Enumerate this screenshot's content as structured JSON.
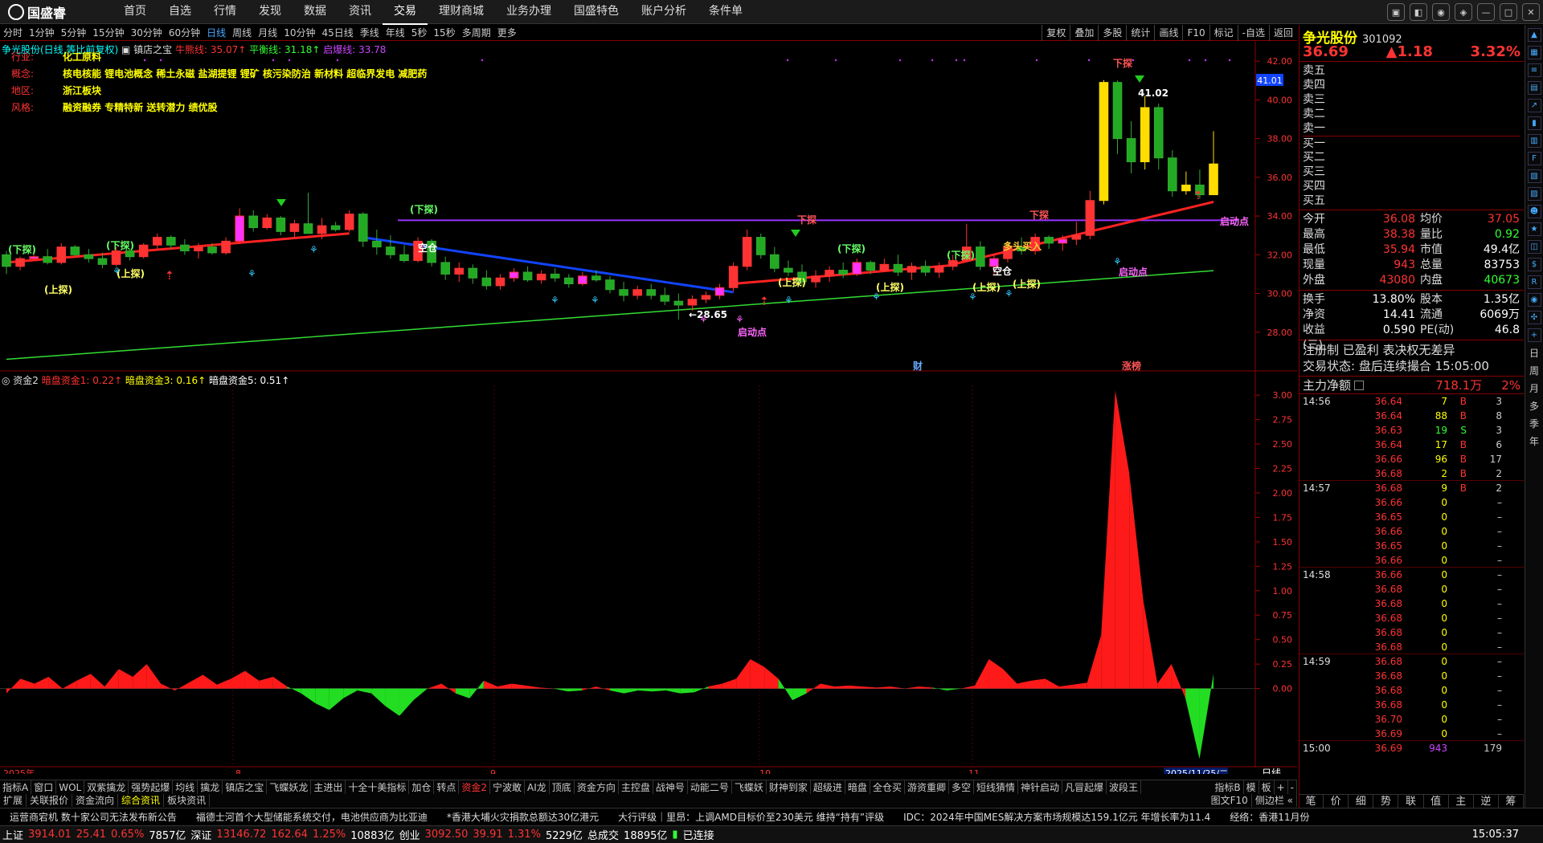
{
  "app": {
    "logo": "国盛睿"
  },
  "menu": [
    "首页",
    "自选",
    "行情",
    "发现",
    "数据",
    "资讯",
    "交易",
    "理财商城",
    "业务办理",
    "国盛特色",
    "账户分析",
    "条件单"
  ],
  "menu_active": 6,
  "window_controls": [
    "msg",
    "min-chat",
    "user",
    "stack",
    "min",
    "max",
    "close"
  ],
  "periods": [
    "分时",
    "1分钟",
    "5分钟",
    "15分钟",
    "30分钟",
    "60分钟",
    "日线",
    "周线",
    "月线",
    "10分钟",
    "45日线",
    "季线",
    "年线",
    "5秒",
    "15秒",
    "多周期",
    "更多"
  ],
  "period_active": 6,
  "right_tools": [
    "复权",
    "叠加",
    "多股",
    "统计",
    "画线",
    "F10",
    "标记",
    "-自选",
    "返回"
  ],
  "chart_header": {
    "stock": "争光股份(日线,等比前复权)",
    "indicator": "镇店之宝",
    "line1": "牛熊线: 35.07↑",
    "line2": "平衡线: 31.18↑",
    "line3": "启爆线: 33.78"
  },
  "info_rows": [
    {
      "k": "行业:",
      "v": "化工原料"
    },
    {
      "k": "概念:",
      "v": "核电核能 锂电池概念 稀土永磁 盐湖提锂 锂矿 核污染防治 新材料 超临界发电 减肥药"
    },
    {
      "k": "地区:",
      "v": "浙江板块"
    },
    {
      "k": "风格:",
      "v": "融资融券 专精特新 送转潜力 绩优股"
    }
  ],
  "sub_header": {
    "name": "资金2",
    "a": "暗盘资金1: 0.22↑",
    "b": "暗盘资金3: 0.16↑",
    "c": "暗盘资金5: 0.51↑"
  },
  "x_axis_labels": [
    {
      "text": "2025年",
      "month": "Jul"
    },
    {
      "text": "8",
      "month": "Aug"
    },
    {
      "text": "9",
      "month": "Sep"
    },
    {
      "text": "10",
      "month": "Oct"
    },
    {
      "text": "11",
      "month": "Nov"
    },
    {
      "text": "2025/11/25/二",
      "month": "cursor"
    }
  ],
  "x_axis_right": "日线",
  "chart_labels": {
    "up_probe": "(上探)",
    "down_probe": "(下探)",
    "down_probe2": "下探",
    "start_point": "启动点",
    "empty_pos": "空仓",
    "buy": "多头买入",
    "low_mark": "←28.65",
    "high_mark": "41.02",
    "fin": "财",
    "limit": "涨榜",
    "price_tag": "41.01"
  },
  "indicator_tabs": [
    "指标A",
    "窗口",
    "WOL",
    "双紫擒龙",
    "强势起爆",
    "均线",
    "擒龙",
    "镇店之宝",
    "飞蝶妖龙",
    "主进出",
    "十全十美指标",
    "加仓",
    "转点",
    "资金2",
    "宁波敢",
    "AI龙",
    "顶底",
    "资金方向",
    "主控盘",
    "战神号",
    "动能二号",
    "飞蝶妖",
    "财神到家",
    "超级进",
    "暗盘",
    "全仓买",
    "游资重卿",
    "多空",
    "短线猜情",
    "神针启动",
    "凡冒起爆",
    "波段王"
  ],
  "indicator_active": 13,
  "indicator_right": [
    "指标B",
    "模",
    "板",
    "+",
    "-"
  ],
  "bottom_tabs": [
    "扩展",
    "关联报价",
    "资金流向",
    "综合资讯",
    "板块资讯"
  ],
  "bottom_tab_active": 3,
  "bottom_right_tabs": [
    "图文F10",
    "侧边栏 «"
  ],
  "news": [
    "运营商宕机 数十家公司无法发布新公告",
    "福德士河首个大型储能系统交付，电池供应商为比亚迪",
    "*香港大埔火灾捐款总额达30亿港元",
    "大行评级｜里昂：上调AMD目标价至230美元 维持“持有”评级",
    "IDC：2024年中国MES解决方案市场规模达159.1亿元 年增长率为11.4",
    "经络：香港11月份"
  ],
  "status": {
    "sh": {
      "name": "上证",
      "v": "3914.01",
      "chg": "25.41",
      "pct": "0.65%",
      "amt": "7857亿"
    },
    "sz": {
      "name": "深证",
      "v": "13146.72",
      "chg": "162.64",
      "pct": "1.25%",
      "amt": "10883亿"
    },
    "cy": {
      "name": "创业",
      "v": "3092.50",
      "chg": "39.91",
      "pct": "1.31%",
      "amt": "5229亿"
    },
    "total_label": "总成交",
    "total": "18895亿",
    "conn": "已连接",
    "time": "15:05:37"
  },
  "quote": {
    "name": "争光股份",
    "code": "301092",
    "price": "36.69",
    "chg": "▲1.18",
    "pct": "3.32%",
    "asks": [
      "卖五",
      "卖四",
      "卖三",
      "卖二",
      "卖一"
    ],
    "bids": [
      "买一",
      "买二",
      "买三",
      "买四",
      "买五"
    ],
    "stats": [
      {
        "l": "今开",
        "v": "36.08",
        "vc": "red",
        "l2": "均价",
        "v2": "37.05",
        "v2c": "red"
      },
      {
        "l": "最高",
        "v": "38.38",
        "vc": "red",
        "l2": "量比",
        "v2": "0.92",
        "v2c": "green"
      },
      {
        "l": "最低",
        "v": "35.94",
        "vc": "red",
        "l2": "市值",
        "v2": "49.4亿",
        "v2c": "white"
      },
      {
        "l": "现量",
        "v": "943",
        "vc": "red",
        "l2": "总量",
        "v2": "83753",
        "v2c": "white"
      },
      {
        "l": "外盘",
        "v": "43080",
        "vc": "red",
        "l2": "内盘",
        "v2": "40673",
        "v2c": "green"
      }
    ],
    "stats2": [
      {
        "l": "换手",
        "v": "13.80%",
        "l2": "股本",
        "v2": "1.35亿"
      },
      {
        "l": "净资",
        "v": "14.41",
        "l2": "流通",
        "v2": "6069万"
      },
      {
        "l": "收益(三)",
        "v": "0.590",
        "l2": "PE(动)",
        "v2": "46.8"
      }
    ],
    "note1": "注册制 已盈利 表决权无差异",
    "note2": "交易状态: 盘后连续撮合 15:05:00",
    "mainflow_label": "主力净额",
    "mainflow_value": "718.1万",
    "mainflow_pct": "2%",
    "ticks": [
      {
        "t": "14:56",
        "p": "36.64",
        "v": "7",
        "s": "B",
        "n": "3"
      },
      {
        "t": "",
        "p": "36.64",
        "v": "88",
        "s": "B",
        "n": "8"
      },
      {
        "t": "",
        "p": "36.63",
        "v": "19",
        "s": "S",
        "n": "3"
      },
      {
        "t": "",
        "p": "36.64",
        "v": "17",
        "s": "B",
        "n": "6"
      },
      {
        "t": "",
        "p": "36.66",
        "v": "96",
        "s": "B",
        "n": "17"
      },
      {
        "t": "",
        "p": "36.68",
        "v": "2",
        "s": "B",
        "n": "2"
      },
      {
        "t": "14:57",
        "p": "36.68",
        "v": "9",
        "s": "B",
        "n": "2"
      },
      {
        "t": "",
        "p": "36.66",
        "v": "0",
        "s": "",
        "n": "–"
      },
      {
        "t": "",
        "p": "36.65",
        "v": "0",
        "s": "",
        "n": "–"
      },
      {
        "t": "",
        "p": "36.66",
        "v": "0",
        "s": "",
        "n": "–"
      },
      {
        "t": "",
        "p": "36.65",
        "v": "0",
        "s": "",
        "n": "–"
      },
      {
        "t": "",
        "p": "36.66",
        "v": "0",
        "s": "",
        "n": "–"
      },
      {
        "t": "14:58",
        "p": "36.66",
        "v": "0",
        "s": "",
        "n": "–"
      },
      {
        "t": "",
        "p": "36.68",
        "v": "0",
        "s": "",
        "n": "–"
      },
      {
        "t": "",
        "p": "36.68",
        "v": "0",
        "s": "",
        "n": "–"
      },
      {
        "t": "",
        "p": "36.68",
        "v": "0",
        "s": "",
        "n": "–"
      },
      {
        "t": "",
        "p": "36.68",
        "v": "0",
        "s": "",
        "n": "–"
      },
      {
        "t": "",
        "p": "36.68",
        "v": "0",
        "s": "",
        "n": "–"
      },
      {
        "t": "14:59",
        "p": "36.68",
        "v": "0",
        "s": "",
        "n": "–"
      },
      {
        "t": "",
        "p": "36.68",
        "v": "0",
        "s": "",
        "n": "–"
      },
      {
        "t": "",
        "p": "36.68",
        "v": "0",
        "s": "",
        "n": "–"
      },
      {
        "t": "",
        "p": "36.68",
        "v": "0",
        "s": "",
        "n": "–"
      },
      {
        "t": "",
        "p": "36.70",
        "v": "0",
        "s": "",
        "n": "–"
      },
      {
        "t": "",
        "p": "36.69",
        "v": "0",
        "s": "",
        "n": "–"
      },
      {
        "t": "15:00",
        "p": "36.69",
        "v": "943",
        "s": "",
        "n": "179"
      }
    ],
    "tabs": [
      "笔",
      "价",
      "细",
      "势",
      "联",
      "值",
      "主",
      "逆",
      "筹"
    ]
  },
  "sidebar_text": [
    "日",
    "周",
    "月",
    "多",
    "季",
    "年"
  ],
  "colors": {
    "up": "#ff3333",
    "down": "#33cc33",
    "bg": "#000000",
    "accent": "#ffff00",
    "purple": "#9933ff",
    "blue": "#1144ff"
  },
  "chart_data": {
    "type": "candlestick",
    "price_axis": {
      "ticks": [
        28.0,
        30.0,
        32.0,
        34.0,
        36.0,
        38.0,
        40.0,
        42.0
      ],
      "ylim": [
        26.0,
        43.0
      ]
    },
    "candles": [
      [
        32.0,
        32.2,
        31.0,
        31.4
      ],
      [
        31.4,
        31.9,
        31.2,
        31.8
      ],
      [
        31.8,
        32.4,
        31.7,
        31.9
      ],
      [
        31.9,
        32.3,
        31.5,
        31.6
      ],
      [
        31.6,
        32.6,
        31.5,
        32.4
      ],
      [
        32.4,
        32.5,
        31.9,
        32.0
      ],
      [
        32.0,
        32.3,
        31.6,
        31.8
      ],
      [
        31.8,
        32.1,
        31.3,
        31.5
      ],
      [
        31.5,
        32.4,
        31.4,
        32.2
      ],
      [
        32.2,
        32.3,
        31.7,
        31.9
      ],
      [
        31.9,
        32.6,
        31.8,
        32.5
      ],
      [
        32.5,
        33.1,
        32.3,
        32.9
      ],
      [
        32.9,
        33.0,
        32.3,
        32.5
      ],
      [
        32.5,
        32.8,
        32.0,
        32.2
      ],
      [
        32.2,
        32.6,
        31.8,
        32.4
      ],
      [
        32.4,
        32.6,
        32.0,
        32.1
      ],
      [
        32.1,
        32.9,
        32.0,
        32.7
      ],
      [
        32.7,
        34.4,
        32.6,
        34.0
      ],
      [
        34.0,
        34.3,
        33.2,
        33.4
      ],
      [
        33.4,
        34.1,
        33.3,
        33.9
      ],
      [
        33.9,
        34.0,
        33.0,
        33.2
      ],
      [
        33.2,
        33.8,
        32.9,
        33.6
      ],
      [
        33.6,
        35.2,
        33.4,
        33.1
      ],
      [
        33.1,
        33.9,
        32.8,
        33.5
      ],
      [
        33.5,
        33.7,
        33.2,
        33.3
      ],
      [
        33.3,
        34.3,
        33.2,
        34.1
      ],
      [
        34.1,
        34.2,
        32.4,
        32.7
      ],
      [
        32.7,
        33.3,
        32.0,
        32.4
      ],
      [
        32.4,
        33.0,
        31.8,
        32.0
      ],
      [
        32.0,
        32.5,
        31.6,
        31.7
      ],
      [
        31.7,
        32.9,
        31.6,
        32.7
      ],
      [
        32.7,
        32.8,
        31.4,
        31.6
      ],
      [
        31.6,
        31.9,
        30.7,
        31.0
      ],
      [
        31.0,
        31.6,
        30.6,
        31.3
      ],
      [
        31.3,
        31.5,
        30.5,
        30.8
      ],
      [
        30.8,
        31.2,
        30.2,
        30.4
      ],
      [
        30.4,
        31.0,
        30.2,
        30.8
      ],
      [
        30.8,
        31.3,
        30.6,
        31.1
      ],
      [
        31.1,
        31.4,
        30.6,
        30.7
      ],
      [
        30.7,
        31.2,
        30.5,
        31.0
      ],
      [
        31.0,
        31.3,
        30.6,
        30.8
      ],
      [
        30.8,
        31.0,
        30.3,
        30.5
      ],
      [
        30.5,
        31.1,
        30.4,
        30.9
      ],
      [
        30.9,
        31.2,
        30.6,
        30.7
      ],
      [
        30.7,
        30.9,
        30.0,
        30.2
      ],
      [
        30.2,
        30.6,
        29.6,
        29.9
      ],
      [
        29.9,
        30.4,
        29.7,
        30.2
      ],
      [
        30.2,
        30.5,
        29.7,
        29.9
      ],
      [
        29.9,
        30.3,
        29.4,
        29.6
      ],
      [
        29.6,
        30.0,
        28.65,
        29.4
      ],
      [
        29.4,
        29.9,
        29.1,
        29.7
      ],
      [
        29.7,
        30.1,
        29.5,
        29.9
      ],
      [
        29.9,
        30.5,
        29.7,
        30.3
      ],
      [
        30.3,
        31.6,
        30.1,
        31.4
      ],
      [
        31.4,
        33.3,
        31.2,
        32.9
      ],
      [
        32.9,
        33.1,
        31.8,
        32.0
      ],
      [
        32.0,
        32.4,
        31.1,
        31.3
      ],
      [
        31.3,
        31.7,
        30.9,
        31.1
      ],
      [
        31.1,
        31.5,
        30.4,
        30.6
      ],
      [
        30.6,
        31.2,
        30.3,
        30.9
      ],
      [
        30.9,
        31.4,
        30.6,
        31.2
      ],
      [
        31.2,
        31.6,
        30.8,
        31.0
      ],
      [
        31.0,
        31.8,
        30.9,
        31.6
      ],
      [
        31.6,
        31.7,
        31.0,
        31.2
      ],
      [
        31.2,
        31.8,
        31.1,
        31.5
      ],
      [
        31.5,
        32.0,
        30.9,
        31.1
      ],
      [
        31.1,
        31.6,
        30.7,
        31.4
      ],
      [
        31.4,
        31.7,
        30.9,
        31.1
      ],
      [
        31.1,
        31.6,
        30.8,
        31.4
      ],
      [
        31.4,
        32.0,
        31.2,
        31.7
      ],
      [
        31.7,
        33.6,
        31.6,
        32.4
      ],
      [
        32.4,
        32.7,
        31.2,
        31.4
      ],
      [
        31.4,
        32.0,
        31.0,
        31.8
      ],
      [
        31.8,
        32.6,
        31.6,
        32.4
      ],
      [
        32.4,
        32.9,
        32.0,
        32.2
      ],
      [
        32.2,
        33.1,
        32.0,
        32.9
      ],
      [
        32.9,
        33.0,
        32.3,
        32.6
      ],
      [
        32.6,
        33.0,
        32.2,
        32.8
      ],
      [
        32.8,
        33.7,
        32.5,
        33.0
      ],
      [
        33.0,
        35.3,
        32.8,
        34.8
      ],
      [
        34.8,
        41.02,
        34.6,
        40.9
      ],
      [
        40.9,
        41.0,
        37.2,
        38.0
      ],
      [
        38.0,
        38.9,
        36.2,
        36.8
      ],
      [
        36.8,
        40.2,
        36.4,
        39.6
      ],
      [
        39.6,
        39.8,
        36.4,
        37.0
      ],
      [
        37.0,
        37.4,
        35.0,
        35.3
      ],
      [
        35.3,
        36.3,
        35.1,
        35.6
      ],
      [
        35.6,
        36.4,
        34.9,
        35.1
      ],
      [
        35.1,
        38.38,
        35.2,
        36.69
      ]
    ],
    "sub_axis": {
      "ticks": [
        0.0,
        0.25,
        0.5,
        0.75,
        1.0,
        1.25,
        1.5,
        1.75,
        2.0,
        2.25,
        2.5,
        2.75,
        3.0
      ],
      "ylim": [
        -0.8,
        3.1
      ]
    },
    "sub_series": [
      -0.05,
      0.1,
      0.05,
      0.12,
      0.0,
      0.08,
      0.15,
      0.02,
      0.2,
      0.12,
      0.25,
      0.05,
      -0.02,
      0.06,
      0.14,
      0.04,
      0.1,
      0.18,
      0.08,
      0.12,
      0.02,
      -0.05,
      -0.15,
      -0.22,
      -0.1,
      -0.02,
      -0.05,
      -0.18,
      -0.28,
      -0.12,
      0.0,
      0.05,
      -0.05,
      -0.1,
      0.08,
      0.02,
      0.05,
      0.03,
      0.01,
      0.0,
      -0.03,
      -0.02,
      0.02,
      -0.02,
      -0.05,
      -0.02,
      -0.03,
      -0.02,
      -0.05,
      -0.04,
      0.02,
      0.05,
      0.1,
      0.3,
      0.22,
      0.1,
      -0.12,
      -0.05,
      0.05,
      0.02,
      0.03,
      0.02,
      0.01,
      0.02,
      0.0,
      0.02,
      0.01,
      -0.02,
      0.0,
      0.03,
      0.3,
      0.2,
      0.05,
      0.08,
      0.1,
      0.02,
      0.04,
      0.06,
      0.55,
      3.05,
      2.2,
      0.9,
      0.05,
      0.25,
      -0.1,
      -0.72,
      0.15
    ],
    "lines": {
      "red": "bull-bear line",
      "blue": "balance segment",
      "green": "long trend",
      "purple": "start line 33.78"
    }
  }
}
